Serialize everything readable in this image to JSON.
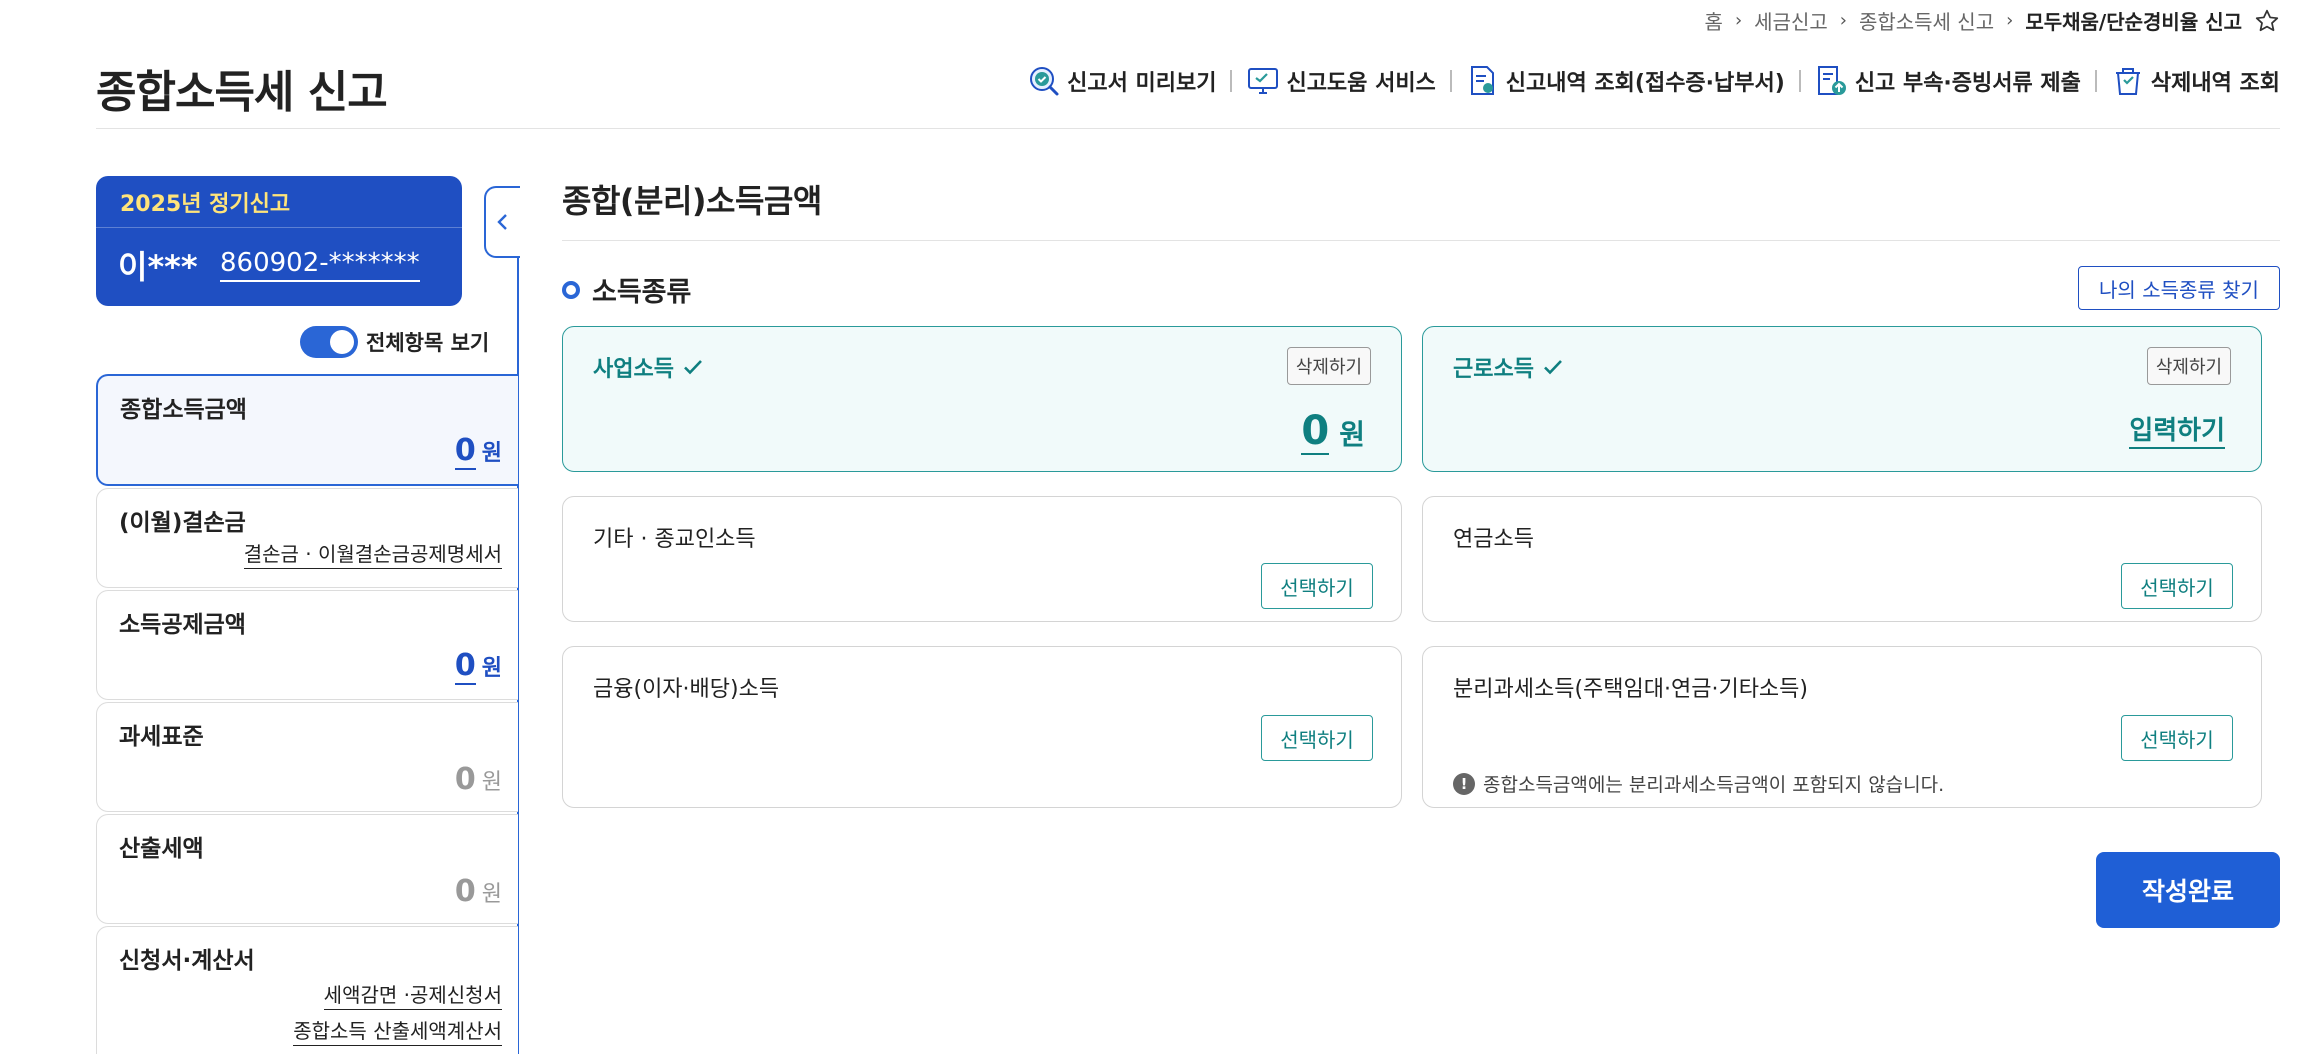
{
  "breadcrumb": [
    "홈",
    "세금신고",
    "종합소득세 신고",
    "모두채움/단순경비율 신고"
  ],
  "page_title": "종합소득세 신고",
  "top_menu": {
    "preview": "신고서 미리보기",
    "help": "신고도움 서비스",
    "history": "신고내역 조회(접수증·납부서)",
    "attach": "신고 부속·증빙서류 제출",
    "deleted": "삭제내역 조회"
  },
  "user": {
    "season": "2025년 정기신고",
    "name": "이***",
    "rrn": "860902-*******"
  },
  "toggle_label": "전체항목 보기",
  "sidebar": {
    "total_income": {
      "title": "종합소득금액",
      "amount": "0",
      "unit": "원"
    },
    "loss": {
      "title": "(이월)결손금",
      "link": "결손금 · 이월결손금공제명세서"
    },
    "deduction": {
      "title": "소득공제금액",
      "amount": "0",
      "unit": "원"
    },
    "tax_base": {
      "title": "과세표준",
      "amount": "0",
      "unit": "원"
    },
    "calc_tax": {
      "title": "산출세액",
      "amount": "0",
      "unit": "원"
    },
    "forms": {
      "title": "신청서·계산서",
      "link1": "세액감면 ·공제신청서",
      "link2": "종합소득 산출세액계산서"
    }
  },
  "main": {
    "section_title": "종합(분리)소득금액",
    "sub_title": "소득종류",
    "find_button": "나의 소득종류 찾기",
    "cards": {
      "business": {
        "title": "사업소득",
        "delete": "삭제하기",
        "amount": "0",
        "unit": "원"
      },
      "wage": {
        "title": "근로소득",
        "delete": "삭제하기",
        "input": "입력하기"
      },
      "other": {
        "title": "기타 · 종교인소득",
        "select": "선택하기"
      },
      "pension": {
        "title": "연금소득",
        "select": "선택하기"
      },
      "financial": {
        "title": "금융(이자·배당)소득",
        "select": "선택하기"
      },
      "separate": {
        "title": "분리과세소득(주택임대·연금·기타소득)",
        "select": "선택하기",
        "note": "종합소득금액에는 분리과세소득금액이 포함되지 않습니다."
      }
    },
    "submit": "작성완료"
  },
  "colors": {
    "primary": "#1f4fc2",
    "teal": "#0f7f80",
    "season": "#ffe47a"
  }
}
